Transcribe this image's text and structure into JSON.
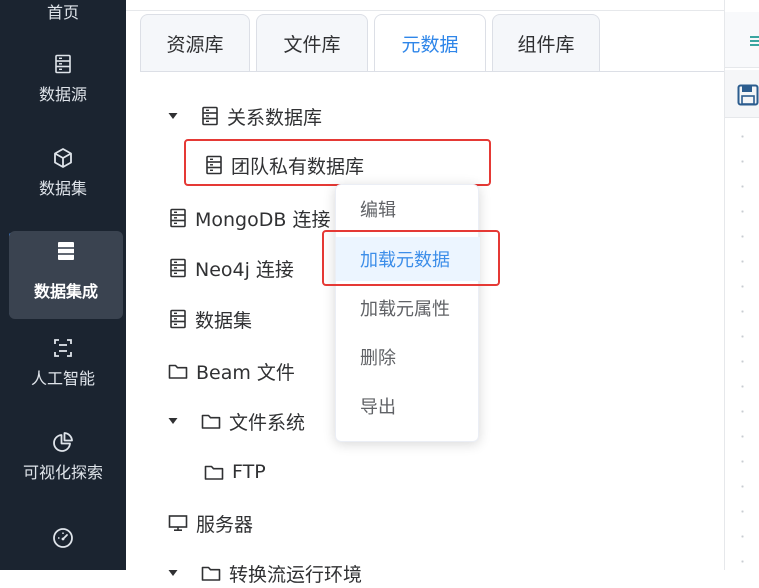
{
  "sidebar": {
    "items": [
      {
        "label": "首页",
        "icon": "home-icon"
      },
      {
        "label": "数据源",
        "icon": "database-icon"
      },
      {
        "label": "数据集",
        "icon": "cube-icon"
      },
      {
        "label": "数据集成",
        "icon": "server-icon",
        "active": true
      },
      {
        "label": "人工智能",
        "icon": "scan-icon"
      },
      {
        "label": "可视化探索",
        "icon": "pie-chart-icon"
      },
      {
        "label": "",
        "icon": "gauge-icon"
      }
    ]
  },
  "tabs": [
    {
      "label": "资源库"
    },
    {
      "label": "文件库"
    },
    {
      "label": "元数据",
      "active": true
    },
    {
      "label": "组件库"
    }
  ],
  "tree": [
    {
      "label": "关系数据库",
      "icon": "database-icon",
      "expanded": true
    },
    {
      "label": "团队私有数据库",
      "icon": "database-icon",
      "highlighted": true
    },
    {
      "label": "MongoDB 连接",
      "icon": "database-icon"
    },
    {
      "label": "Neo4j 连接",
      "icon": "database-icon"
    },
    {
      "label": "数据集",
      "icon": "database-icon"
    },
    {
      "label": "Beam 文件",
      "icon": "folder-icon"
    },
    {
      "label": "文件系统",
      "icon": "folder-icon",
      "expanded": true
    },
    {
      "label": "FTP",
      "icon": "folder-icon"
    },
    {
      "label": "服务器",
      "icon": "monitor-icon"
    },
    {
      "label": "转换流运行环境",
      "icon": "folder-icon",
      "partial": true
    }
  ],
  "context_menu": {
    "items": [
      {
        "label": "编辑"
      },
      {
        "label": "加载元数据",
        "hovered": true
      },
      {
        "label": "加载元属性"
      },
      {
        "label": "删除"
      },
      {
        "label": "导出"
      }
    ]
  },
  "colors": {
    "sidebar_bg": "#1b2430",
    "accent": "#2f86e9",
    "highlight_border": "#e53935",
    "menu_hover_bg": "#ecf5ff"
  }
}
